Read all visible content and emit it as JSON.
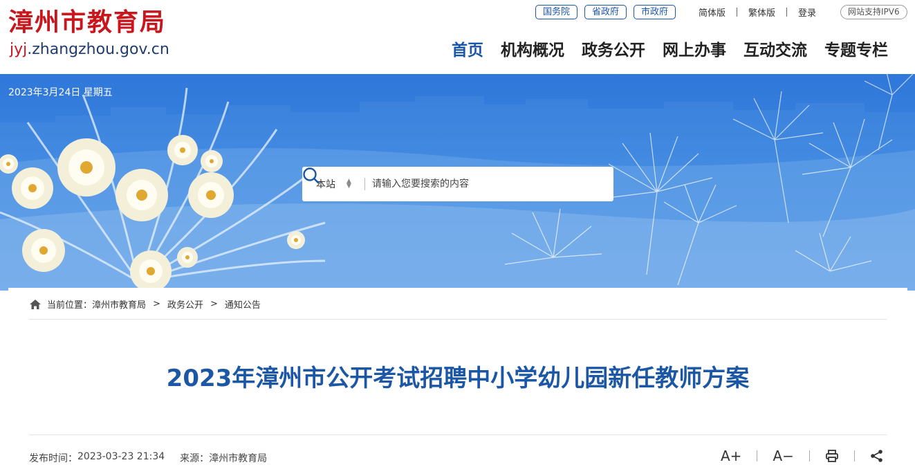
{
  "site": {
    "title": "漳州市教育局",
    "domain_prefix": "jyj",
    "domain_rest": ".zhangzhou.gov.cn",
    "brand_color": "#c8161d",
    "accent_color": "#1a56a8"
  },
  "top_links": [
    "国务院",
    "省政府",
    "市政府"
  ],
  "top_right": {
    "simplified": "简体版",
    "traditional": "繁体版",
    "login": "登录",
    "ipv6": "网站支持IPV6"
  },
  "nav": {
    "items": [
      "首页",
      "机构概况",
      "政务公开",
      "网上办事",
      "互动交流",
      "专题专栏"
    ],
    "active_index": 0
  },
  "banner": {
    "date": "2023年3月24日 星期五"
  },
  "search": {
    "scope": "本站",
    "placeholder": "请输入您要搜索的内容",
    "icon": "search-icon"
  },
  "breadcrumb": {
    "prefix": "当前位置：",
    "items": [
      "漳州市教育局",
      "政务公开",
      "通知公告"
    ],
    "separator": ">"
  },
  "article": {
    "title": "2023年漳州市公开考试招聘中小学幼儿园新任教师方案",
    "publish_label": "发布时间：",
    "publish_time": "2023-03-23 21:34",
    "source_label": "来源：",
    "source": "漳州市教育局"
  },
  "tools": {
    "font_increase": "A+",
    "font_decrease": "A−",
    "print_icon": "print-icon",
    "share_icon": "share-icon"
  }
}
